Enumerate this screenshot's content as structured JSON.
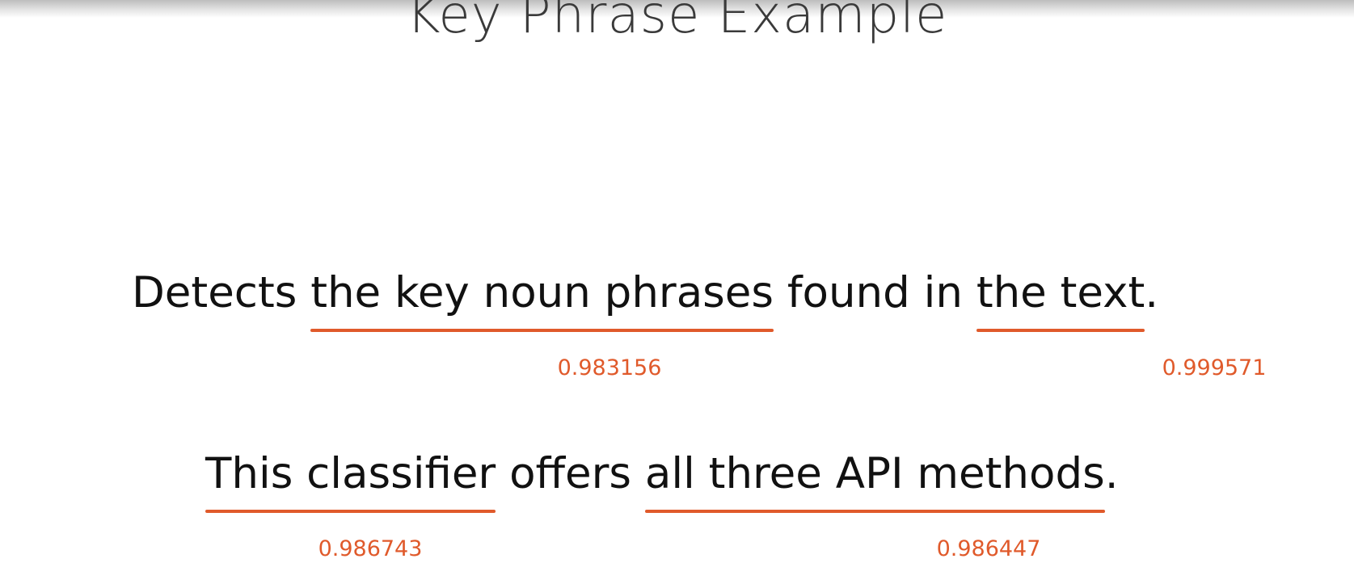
{
  "slide": {
    "title": "Key Phrase Example",
    "accent_color": "#e05a2b"
  },
  "sentences": [
    {
      "segments": [
        {
          "text": "Detects ",
          "key": false
        },
        {
          "text": "the key noun phrases",
          "key": true,
          "score": "0.983156"
        },
        {
          "text": " found in ",
          "key": false
        },
        {
          "text": "the text",
          "key": true,
          "score": "0.999571"
        },
        {
          "text": ".",
          "key": false
        }
      ]
    },
    {
      "segments": [
        {
          "text": "This classifier",
          "key": true,
          "score": "0.986743"
        },
        {
          "text": " offers ",
          "key": false
        },
        {
          "text": "all three API methods",
          "key": true,
          "score": "0.986447"
        },
        {
          "text": ".",
          "key": false
        }
      ]
    }
  ]
}
